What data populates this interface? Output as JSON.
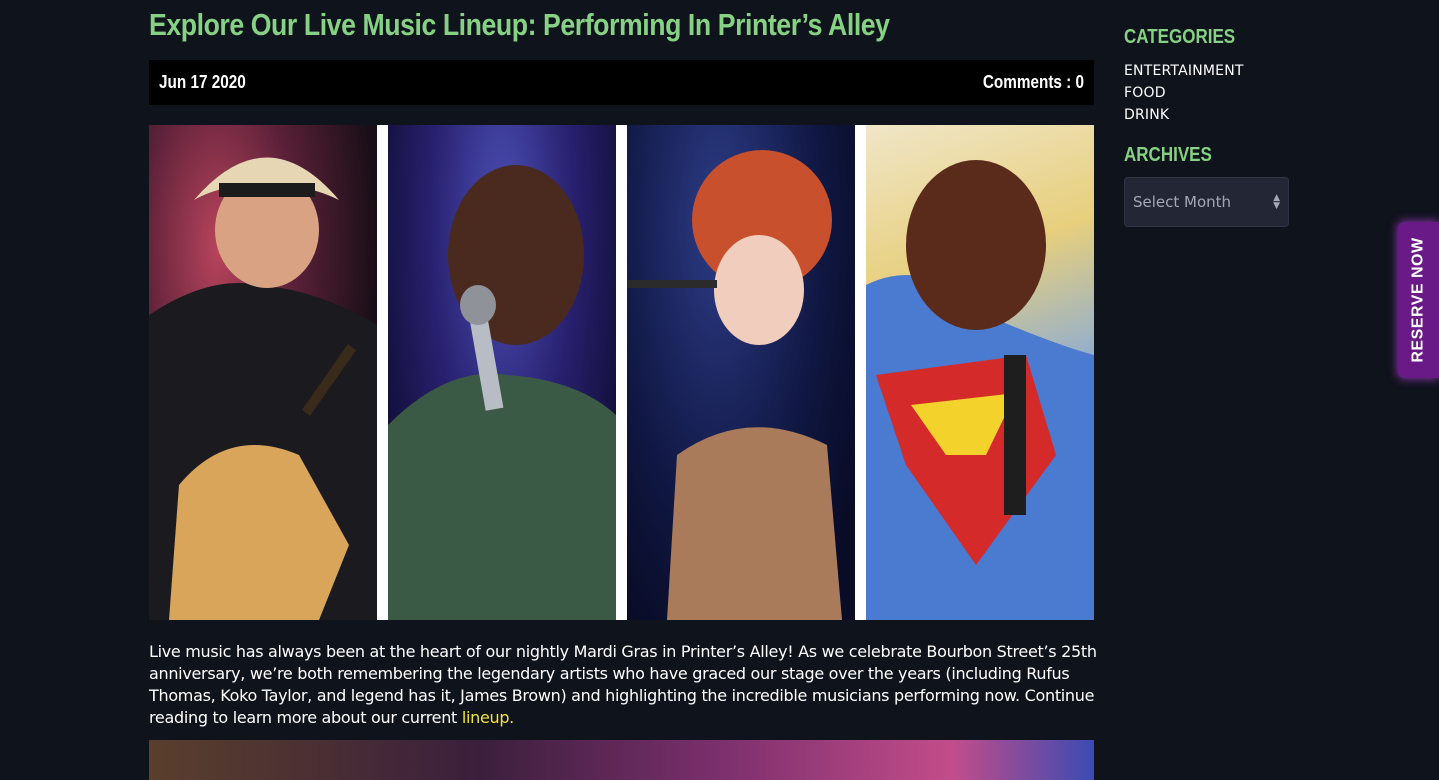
{
  "post": {
    "title": "Explore Our Live Music Lineup: Performing In Printer’s Alley",
    "date": "Jun 17 2020",
    "comments": "Comments : 0",
    "body": "Live music has always been at the heart of our nightly Mardi Gras in Printer’s Alley! As we celebrate Bourbon Street’s 25th anniversary, we’re both remembering the legendary artists who have graced our stage over the years (including Rufus Thomas, Koko Taylor, and legend has it, James Brown) and highlighting the incredible musicians performing now. Continue reading to learn more about our current ",
    "link_text": "lineup.",
    "link_color": "#f2e33a"
  },
  "sidebar": {
    "categories_heading": "CATEGORIES",
    "categories": [
      "ENTERTAINMENT",
      "FOOD",
      "DRINK"
    ],
    "archives_heading": "ARCHIVES",
    "archive_select_value": "Select Month"
  },
  "reserve_tab": {
    "label": "RESERVE NOW",
    "color": "#6a1a86"
  },
  "colors": {
    "accent_green": "#86d183",
    "background": "#0f131c",
    "meta_bar": "#000000"
  },
  "icons": {
    "select": "select-updown-icon"
  }
}
